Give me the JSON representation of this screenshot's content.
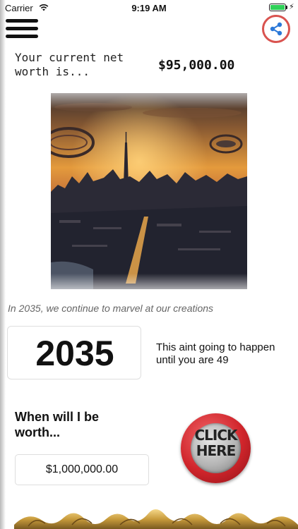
{
  "status_bar": {
    "carrier": "Carrier",
    "time": "9:19 AM",
    "battery_level": 1.0
  },
  "header": {
    "menu_icon": "hamburger-menu-icon",
    "share_icon": "share-icon"
  },
  "net_worth": {
    "label": "Your current net worth is...",
    "value": "$95,000.00"
  },
  "image": {
    "caption": "In 2035, we continue to marvel at our creations"
  },
  "result": {
    "year": "2035",
    "message": "This aint going to happen until you are 49"
  },
  "goal": {
    "question": "When will I be worth...",
    "target_value": "$1,000,000.00"
  },
  "click_button": {
    "line1": "CLICK",
    "line2": "HERE"
  },
  "colors": {
    "accent_red": "#d0252b",
    "battery_green": "#2fd158",
    "caption_gray": "#666666"
  }
}
